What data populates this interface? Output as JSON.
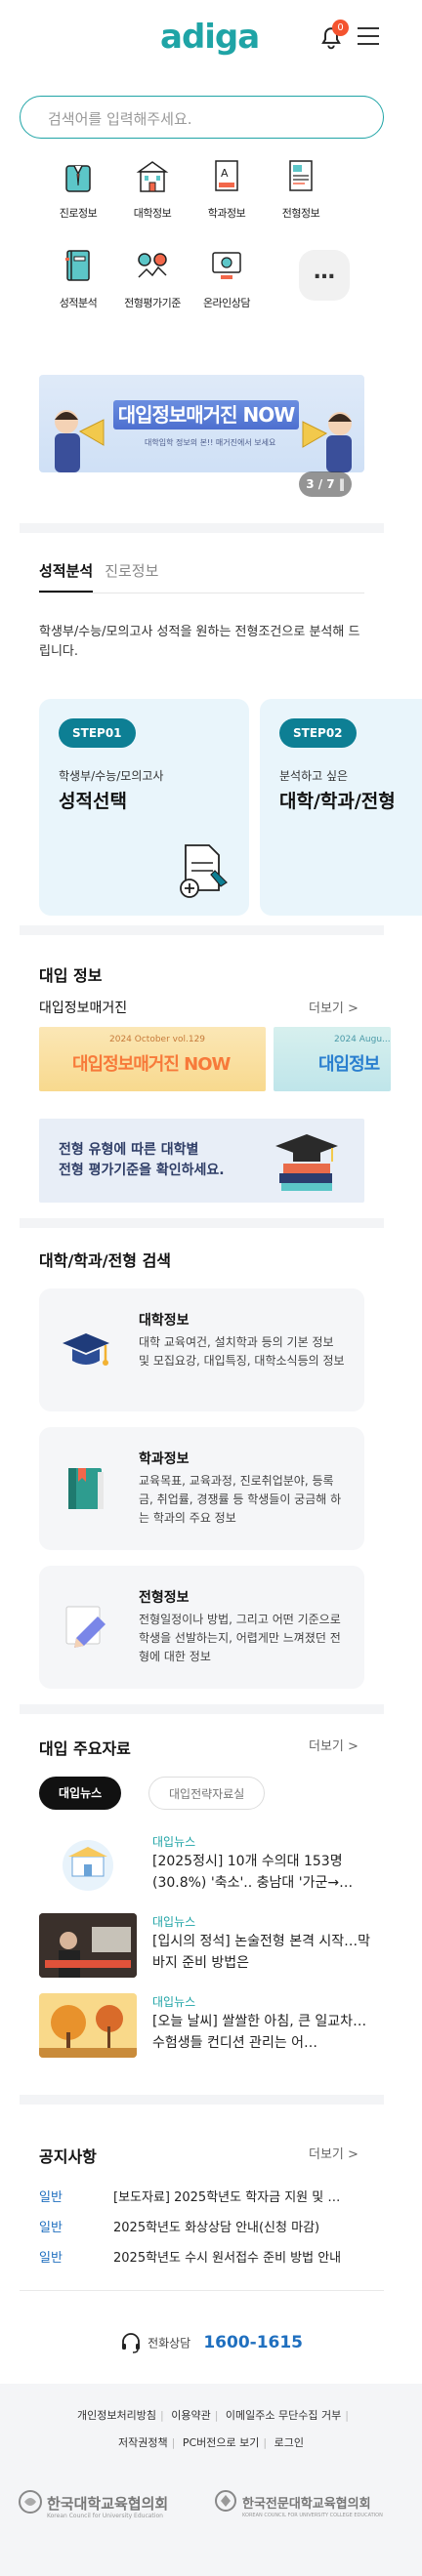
{
  "header": {
    "logo": "adiga",
    "notification_count": "0"
  },
  "search": {
    "placeholder": "검색어를 입력해주세요."
  },
  "quick_menu": [
    {
      "label": "진로정보",
      "icon": "career-icon"
    },
    {
      "label": "대학정보",
      "icon": "university-icon"
    },
    {
      "label": "학과정보",
      "icon": "major-book-icon"
    },
    {
      "label": "전형정보",
      "icon": "document-icon"
    },
    {
      "label": "성적분석",
      "icon": "notebook-icon"
    },
    {
      "label": "전형평가기준",
      "icon": "evaluation-icon"
    },
    {
      "label": "온라인상담",
      "icon": "online-counsel-icon"
    }
  ],
  "more_button": "…",
  "banner": {
    "title": "대입정보매거진 NOW",
    "subtitle": "대학입학 정보의 본!! 매거진에서 보세요",
    "pager": "3 / 7"
  },
  "grade": {
    "tabs": [
      "성적분석",
      "진로정보"
    ],
    "description": "학생부/수능/모의고사 성적을 원하는 전형조건으로 분석해 드립니다.",
    "steps": [
      {
        "badge": "STEP01",
        "small": "학생부/수능/모의고사",
        "big": "성적선택"
      },
      {
        "badge": "STEP02",
        "small": "분석하고 싶은",
        "big": "대학/학과/전형"
      }
    ]
  },
  "admissions": {
    "title": "대입 정보",
    "magazine_title": "대입정보매거진",
    "more": "더보기 >",
    "magazines": [
      {
        "issue": "2024 October vol.129",
        "title": "대입정보매거진 NOW"
      },
      {
        "issue": "2024 Augu...",
        "title": "대입정보"
      }
    ],
    "guide": "전형 유형에 따른 대학별\n전형 평가기준을 확인하세요."
  },
  "univ_search": {
    "title": "대학/학과/전형 검색",
    "cards": [
      {
        "title": "대학정보",
        "desc": "대학 교육여건, 설치학과 등의 기본 정보 및 모집요강, 대입특징, 대학소식등의 정보"
      },
      {
        "title": "학과정보",
        "desc": "교육목표, 교육과정, 진로취업분야, 등록금, 취업률, 경쟁률 등 학생들이 궁금해 하는 학과의 주요 정보"
      },
      {
        "title": "전형정보",
        "desc": "전형일정이나 방법, 그리고 어떤 기준으로 학생을 선발하는지, 어렵게만 느껴졌던 전형에 대한 정보"
      }
    ]
  },
  "news": {
    "title": "대입 주요자료",
    "more": "더보기 >",
    "tabs": [
      "대입뉴스",
      "대입전략자료실"
    ],
    "items": [
      {
        "category": "대입뉴스",
        "title": "[2025정시] 10개 수의대 153명(30.8%) '축소'.. 충남대 '가군→…"
      },
      {
        "category": "대입뉴스",
        "title": "[입시의 정석] 논술전형 본격 시작…막바지 준비 방법은"
      },
      {
        "category": "대입뉴스",
        "title": "[오늘 날씨] 쌀쌀한 아침, 큰 일교차…수험생들 컨디션 관리는 어…"
      }
    ]
  },
  "notices": {
    "title": "공지사항",
    "more": "더보기 >",
    "items": [
      {
        "type": "일반",
        "title": "[보도자료] 2025학년도 학자금 지원 및 …"
      },
      {
        "type": "일반",
        "title": "2025학년도 화상상담 안내(신청 마감)"
      },
      {
        "type": "일반",
        "title": "2025학년도 수시 원서접수 준비 방법 안내"
      }
    ]
  },
  "contact": {
    "label": "전화상담",
    "number": "1600-1615"
  },
  "footer": {
    "links_row1": [
      "개인정보처리방침",
      "이용약관",
      "이메일주소 무단수집 거부"
    ],
    "links_row2": [
      "저작권정책",
      "PC버전으로 보기",
      "로그인"
    ],
    "orgs": [
      {
        "name": "한국대학교육협의회",
        "en": "Korean Council for University Education"
      },
      {
        "name": "한국전문대학교육협의회",
        "en": "KOREAN COUNCIL FOR UNIVERSITY COLLEGE EDUCATION"
      }
    ]
  },
  "colors": {
    "brand": "#1fa4a6",
    "step_badge": "#0d7f94",
    "link_blue": "#1f6fbf",
    "badge_red": "#f4532f"
  }
}
